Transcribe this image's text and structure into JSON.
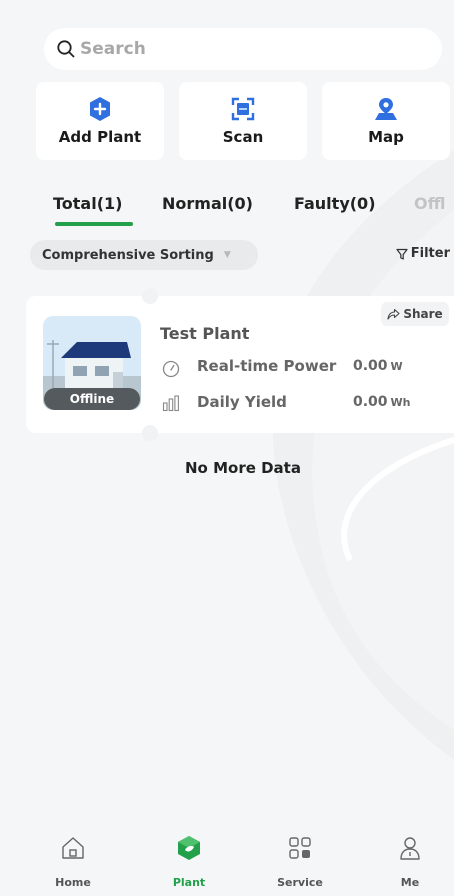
{
  "search": {
    "placeholder": "Search"
  },
  "quick_actions": [
    {
      "label": "Add Plant",
      "icon": "add-plant-icon"
    },
    {
      "label": "Scan",
      "icon": "scan-icon"
    },
    {
      "label": "Map",
      "icon": "map-icon"
    }
  ],
  "tabs": [
    {
      "label": "Total(1)",
      "active": true
    },
    {
      "label": "Normal(0)"
    },
    {
      "label": "Faulty(0)"
    },
    {
      "label": "Offl"
    }
  ],
  "sort": {
    "label": "Comprehensive Sorting",
    "caret": "▼"
  },
  "filter": {
    "label": "Filter"
  },
  "plant": {
    "name": "Test Plant",
    "status": "Offline",
    "share_label": "Share",
    "realtime_power_label": "Real-time Power",
    "realtime_power_value": "0.00",
    "realtime_power_unit": "W",
    "daily_yield_label": "Daily Yield",
    "daily_yield_value": "0.00",
    "daily_yield_unit": "Wh"
  },
  "no_more": "No More Data",
  "nav": [
    {
      "label": "Home",
      "icon": "home-icon"
    },
    {
      "label": "Plant",
      "icon": "plant-icon",
      "active": true
    },
    {
      "label": "Service",
      "icon": "service-icon"
    },
    {
      "label": "Me",
      "icon": "profile-icon"
    }
  ],
  "colors": {
    "accent": "#22a04a",
    "icon_blue": "#2f6fe0",
    "offline": "#555a5e"
  }
}
